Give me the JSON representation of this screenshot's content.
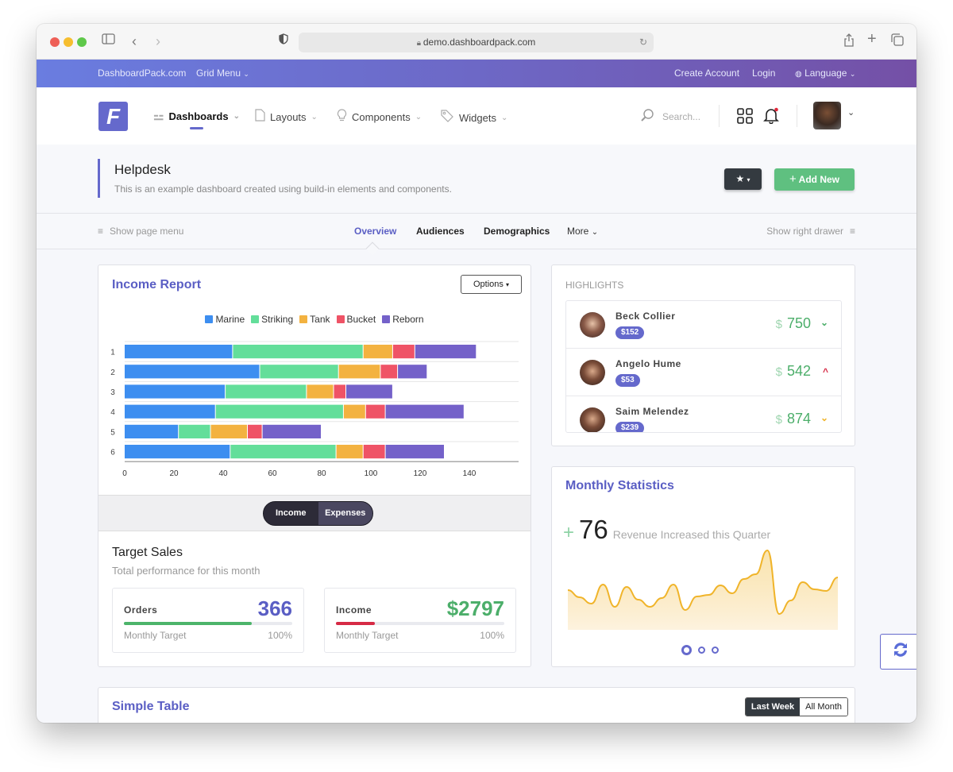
{
  "browser": {
    "url": "demo.dashboardpack.com"
  },
  "topnav": {
    "brand": "DashboardPack.com",
    "grid_menu": "Grid Menu",
    "create_account": "Create Account",
    "login": "Login",
    "language": "Language"
  },
  "header": {
    "logo_letter": "F",
    "nav": [
      {
        "label": "Dashboards",
        "icon": "signpost-icon",
        "active": true
      },
      {
        "label": "Layouts",
        "icon": "file-icon"
      },
      {
        "label": "Components",
        "icon": "lightbulb-icon"
      },
      {
        "label": "Widgets",
        "icon": "tags-icon"
      }
    ],
    "search_placeholder": "Search..."
  },
  "page": {
    "title": "Helpdesk",
    "subtitle": "This is an example dashboard created using build-in elements and components.",
    "add_new": "Add New"
  },
  "subnav": {
    "show_page_menu": "Show page menu",
    "tabs": [
      "Overview",
      "Audiences",
      "Demographics",
      "More"
    ],
    "active_tab": "Overview",
    "show_right_drawer": "Show right drawer"
  },
  "income_report": {
    "title": "Income Report",
    "options_label": "Options",
    "toggle": [
      "Income",
      "Expenses"
    ],
    "active_toggle": "Income"
  },
  "chart_data": [
    {
      "type": "bar",
      "orientation": "horizontal",
      "stacked": true,
      "title": "Income Report",
      "categories": [
        "1",
        "2",
        "3",
        "4",
        "5",
        "6"
      ],
      "series": [
        {
          "name": "Marine",
          "color": "#3d8ef0",
          "values": [
            44,
            55,
            41,
            37,
            22,
            43
          ]
        },
        {
          "name": "Striking",
          "color": "#63de9a",
          "values": [
            53,
            32,
            33,
            52,
            13,
            43
          ]
        },
        {
          "name": "Tank",
          "color": "#f3b240",
          "values": [
            12,
            17,
            11,
            9,
            15,
            11
          ]
        },
        {
          "name": "Bucket",
          "color": "#ef5366",
          "values": [
            9,
            7,
            5,
            8,
            6,
            9
          ]
        },
        {
          "name": "Reborn",
          "color": "#7461c9",
          "values": [
            25,
            12,
            19,
            32,
            24,
            24
          ]
        }
      ],
      "xticks": [
        0,
        20,
        40,
        60,
        80,
        100,
        120,
        140
      ],
      "xlim": [
        0,
        160
      ],
      "legend": "top-center",
      "grid": true
    },
    {
      "type": "area",
      "title": "Monthly Statistics sparkline",
      "values": [
        50,
        41,
        33,
        57,
        29,
        54,
        38,
        29,
        40,
        57,
        25,
        42,
        44,
        56,
        46,
        64,
        70,
        100,
        20,
        37,
        60,
        51,
        49,
        66
      ],
      "color": "#f0b42a",
      "ylim": [
        0,
        105
      ]
    }
  ],
  "target_sales": {
    "title": "Target Sales",
    "subtitle": "Total performance for this month",
    "cards": [
      {
        "label": "Orders",
        "value": "366",
        "progress_pct": 76,
        "foot_left": "Monthly Target",
        "foot_right": "100%",
        "color": "#5a5ec4",
        "bar_color": "#4cb46a"
      },
      {
        "label": "Income",
        "value": "$2797",
        "progress_pct": 23,
        "foot_left": "Monthly Target",
        "foot_right": "100%",
        "color": "#4cae6a",
        "bar_color": "#d62a45"
      }
    ]
  },
  "highlights": {
    "title": "HIGHLIGHTS",
    "items": [
      {
        "name": "Beck Collier",
        "badge": "$152",
        "currency": "$",
        "amount": "750",
        "trend": "down",
        "trend_color": "#4cae6a"
      },
      {
        "name": "Angelo Hume",
        "badge": "$53",
        "currency": "$",
        "amount": "542",
        "trend": "up",
        "trend_color": "#d62a45"
      },
      {
        "name": "Saim Melendez",
        "badge": "$239",
        "currency": "$",
        "amount": "874",
        "trend": "down",
        "trend_color": "#f0b42a"
      }
    ]
  },
  "monthly_stats": {
    "title": "Monthly Statistics",
    "sign": "+",
    "value": "76",
    "caption": "Revenue Increased this Quarter",
    "carousel_dots": 3,
    "active_dot": 1
  },
  "simple_table": {
    "title": "Simple Table",
    "buttons": [
      "Last Week",
      "All Month"
    ],
    "active_button": "Last Week"
  }
}
